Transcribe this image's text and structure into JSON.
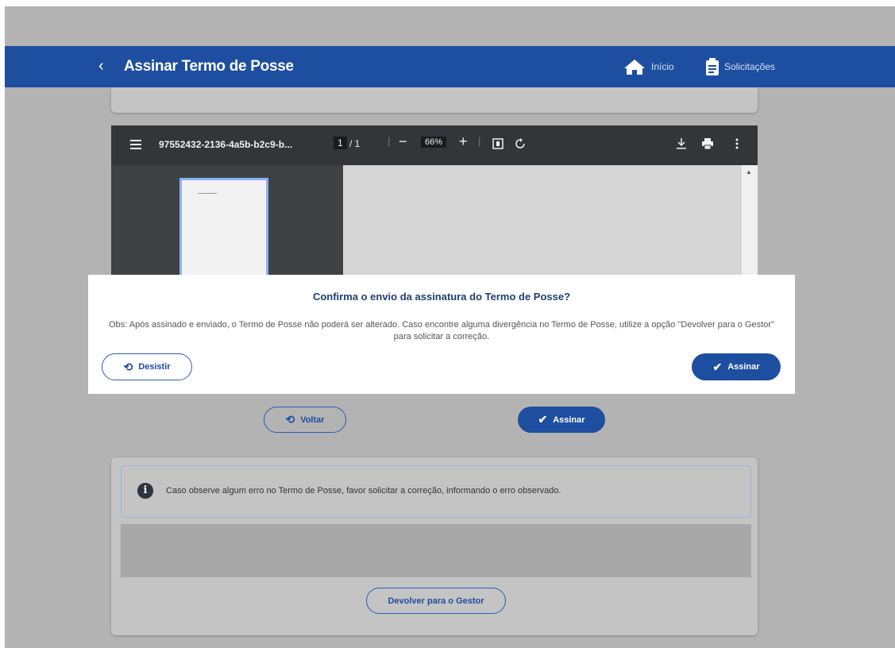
{
  "header": {
    "back_icon": "chevron-left-icon",
    "title": "Assinar Termo de Posse",
    "nav": [
      {
        "label": "Início",
        "icon": "home-icon"
      },
      {
        "label": "Solicitações",
        "icon": "clipboard-icon"
      }
    ]
  },
  "pdf_viewer": {
    "filename": "97552432-2136-4a5b-b2c9-b...",
    "page_current": "1",
    "page_total": "/ 1",
    "zoom": "66%",
    "icons": [
      "menu-icon",
      "zoom-out-icon",
      "zoom-in-icon",
      "fit-page-icon",
      "rotate-icon",
      "download-icon",
      "print-icon",
      "more-icon"
    ]
  },
  "actions": {
    "back_label": "Voltar",
    "sign_label": "Assinar"
  },
  "info": {
    "text": "Caso observe algum erro no Termo de Posse, favor solicitar a correção, informando o erro observado."
  },
  "return_button": {
    "label": "Devolver para o Gestor"
  },
  "modal": {
    "title": "Confirma o envio da assinatura do Termo de Posse?",
    "text": "Obs: Após assinado e enviado, o Termo de Posse não poderá ser alterado. Caso encontre alguma divergência no Termo de Posse, utilize a opção \"Devolver para o Gestor\" para solicitar a correção.",
    "cancel_label": "Desistir",
    "confirm_label": "Assinar"
  },
  "colors": {
    "brand": "#1d4ea0",
    "overlay": "#b3b3b3",
    "pdf_toolbar": "#323639"
  }
}
